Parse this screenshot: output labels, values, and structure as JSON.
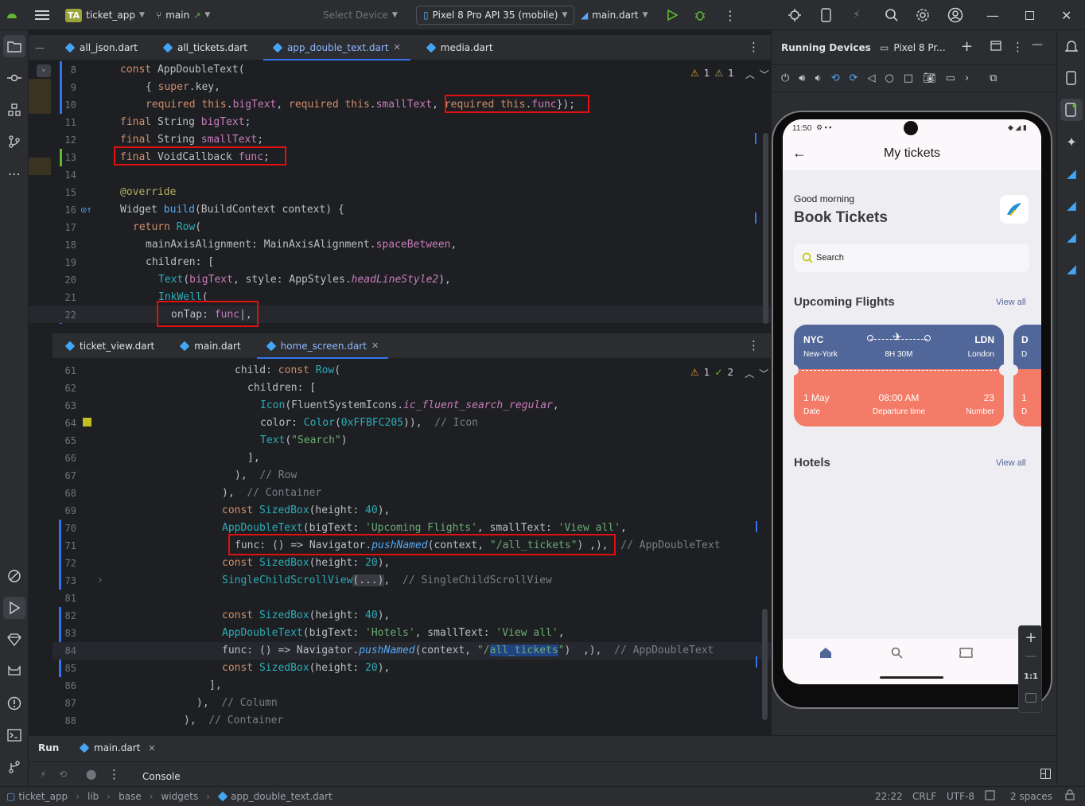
{
  "topbar": {
    "project_badge": "TA",
    "project_name": "ticket_app",
    "branch": "main",
    "select_device": "Select Device",
    "device": "Pixel 8 Pro API 35 (mobile)",
    "run_config": "main.dart"
  },
  "editor_top": {
    "tabs": [
      {
        "label": "all_json.dart"
      },
      {
        "label": "all_tickets.dart"
      },
      {
        "label": "app_double_text.dart"
      },
      {
        "label": "media.dart"
      }
    ],
    "warnings": "1",
    "weak_warnings": "1",
    "line_numbers": [
      "8",
      "9",
      "10",
      "11",
      "12",
      "13",
      "14",
      "15",
      "16",
      "17",
      "18",
      "19",
      "20",
      "21",
      "22"
    ]
  },
  "editor_bottom": {
    "tabs": [
      {
        "label": "ticket_view.dart"
      },
      {
        "label": "main.dart"
      },
      {
        "label": "home_screen.dart"
      }
    ],
    "warnings": "1",
    "checks": "2",
    "line_numbers": [
      "61",
      "62",
      "63",
      "64",
      "65",
      "66",
      "67",
      "68",
      "69",
      "70",
      "71",
      "72",
      "73",
      "81",
      "82",
      "83",
      "84",
      "85",
      "86",
      "87",
      "88"
    ]
  },
  "device_panel": {
    "title": "Running Devices",
    "device_tab": "Pixel 8 Pr...",
    "zoom_label": "1:1"
  },
  "phone": {
    "status_time": "11:50",
    "appbar_title": "My tickets",
    "greeting": "Good morning",
    "headline": "Book Tickets",
    "search_placeholder": "Search",
    "upcoming_title": "Upcoming Flights",
    "view_all_1": "View all",
    "ticket": {
      "from_code": "NYC",
      "from_name": "New-York",
      "duration": "8H 30M",
      "to_code": "LDN",
      "to_name": "London",
      "date": "1 May",
      "date_label": "Date",
      "time": "08:00 AM",
      "time_label": "Departure time",
      "number": "23",
      "number_label": "Number",
      "next_code": "D",
      "next_name": "D",
      "next_date": "1",
      "next_label": "D"
    },
    "hotels_title": "Hotels",
    "view_all_2": "View all"
  },
  "run_panel": {
    "title": "Run",
    "tab": "main.dart",
    "console": "Console"
  },
  "statusbar": {
    "crumbs": [
      "ticket_app",
      "lib",
      "base",
      "widgets",
      "app_double_text.dart"
    ],
    "position": "22:22",
    "line_sep": "CRLF",
    "encoding": "UTF-8",
    "indent": "2 spaces"
  },
  "colors": {
    "accent": "#3574f0",
    "highlight_box": "#e01010",
    "ticket_top": "#526799",
    "ticket_bottom": "#f37b67"
  }
}
